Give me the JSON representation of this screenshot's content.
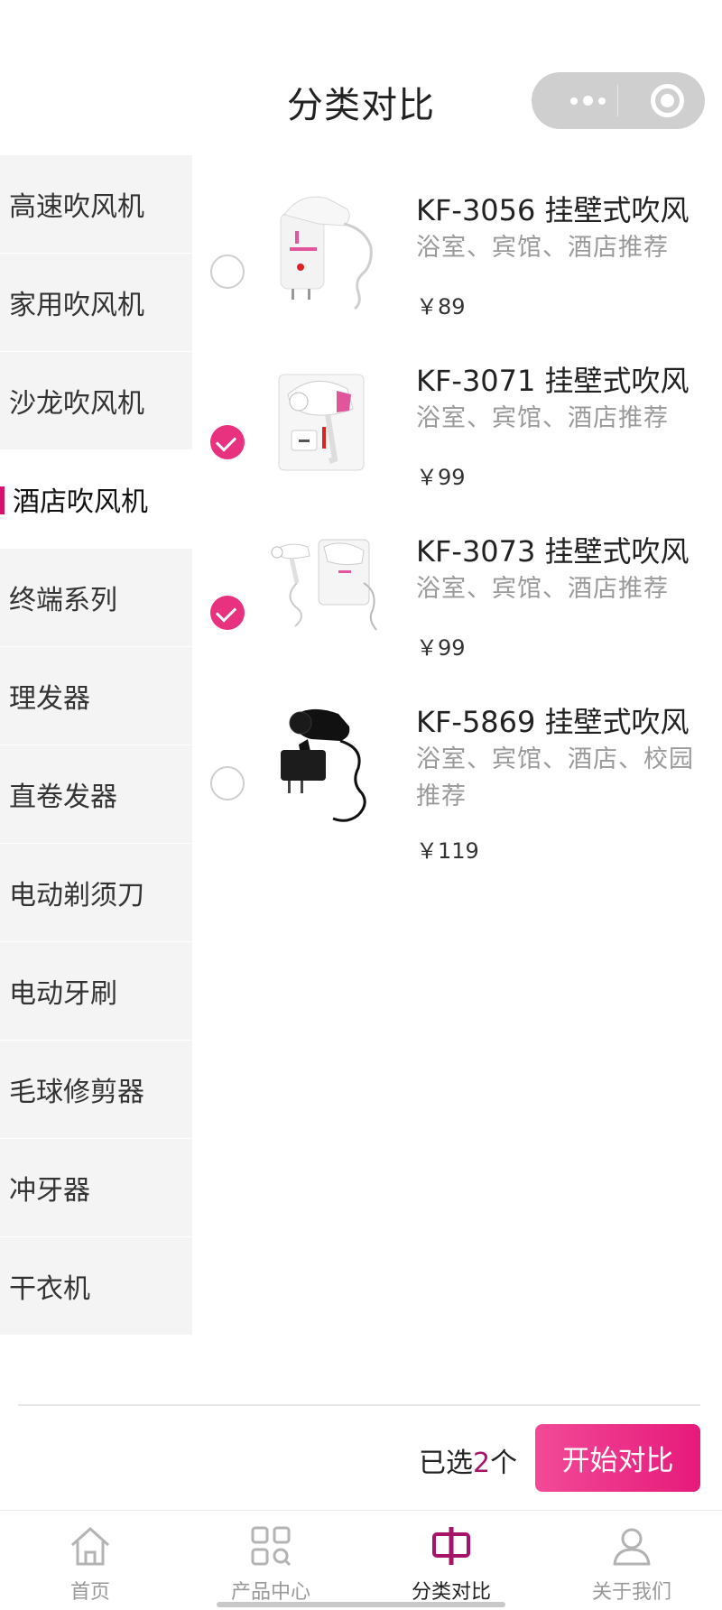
{
  "header": {
    "title": "分类对比"
  },
  "capsule": {
    "menu_icon": "more-dots-icon",
    "close_icon": "target-circle-icon"
  },
  "sidebar": {
    "items": [
      {
        "label": "高速吹风机",
        "active": false
      },
      {
        "label": "家用吹风机",
        "active": false
      },
      {
        "label": "沙龙吹风机",
        "active": false
      },
      {
        "label": "酒店吹风机",
        "active": true
      },
      {
        "label": "终端系列",
        "active": false
      },
      {
        "label": "理发器",
        "active": false
      },
      {
        "label": "直卷发器",
        "active": false
      },
      {
        "label": "电动剃须刀",
        "active": false
      },
      {
        "label": "电动牙刷",
        "active": false
      },
      {
        "label": "毛球修剪器",
        "active": false
      },
      {
        "label": "冲牙器",
        "active": false
      },
      {
        "label": "干衣机",
        "active": false
      }
    ]
  },
  "products": [
    {
      "name": "KF-3056 挂壁式吹风",
      "desc": "浴室、宾馆、酒店推荐",
      "price": "￥89",
      "selected": false
    },
    {
      "name": "KF-3071 挂壁式吹风",
      "desc": "浴室、宾馆、酒店推荐",
      "price": "￥99",
      "selected": true
    },
    {
      "name": "KF-3073 挂壁式吹风",
      "desc": "浴室、宾馆、酒店推荐",
      "price": "￥99",
      "selected": true
    },
    {
      "name": "KF-5869 挂壁式吹风",
      "desc": "浴室、宾馆、酒店、校园推荐",
      "price": "￥119",
      "selected": false
    }
  ],
  "compare_bar": {
    "selected_prefix": "已选",
    "selected_count": "2",
    "selected_suffix": "个",
    "button_label": "开始对比"
  },
  "tabbar": {
    "tabs": [
      {
        "label": "首页",
        "icon": "home-icon",
        "active": false
      },
      {
        "label": "产品中心",
        "icon": "grid-search-icon",
        "active": false
      },
      {
        "label": "分类对比",
        "icon": "compare-icon",
        "active": true
      },
      {
        "label": "关于我们",
        "icon": "user-icon",
        "active": false
      }
    ]
  },
  "colors": {
    "accent": "#e6197a",
    "accent_dark": "#a5146a",
    "sidebar_bg": "#f4f4f4"
  }
}
